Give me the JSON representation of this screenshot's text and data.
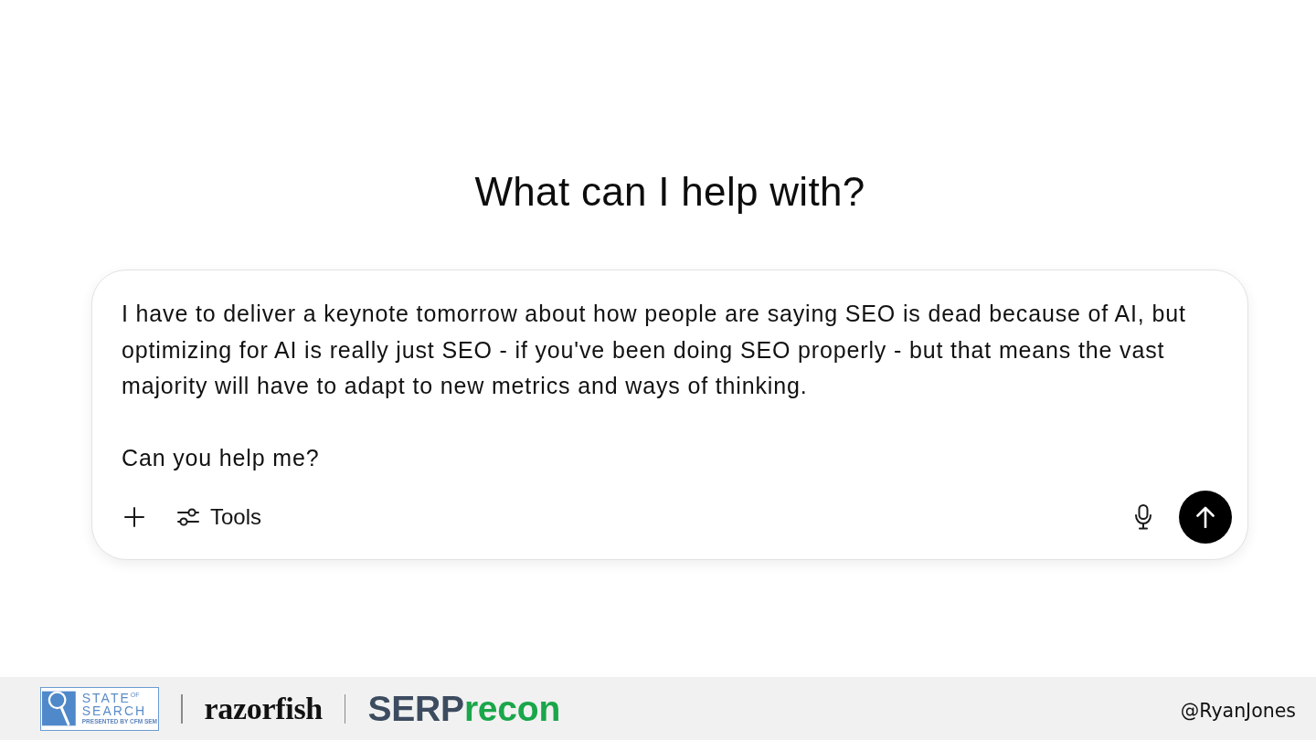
{
  "heading": "What can I help with?",
  "composer": {
    "value": "I have to deliver a keynote tomorrow about how people are saying SEO is dead because of AI, but optimizing for AI is really just SEO - if you've been doing SEO properly - but that means the vast majority will have to adapt to new metrics and ways of thinking.\n\nCan you help me?",
    "tools_label": "Tools"
  },
  "footer": {
    "logos": [
      {
        "kind": "badge",
        "title": [
          "STATE",
          "OF",
          "SEARCH"
        ],
        "tagline": "PRESENTED BY CFM SEM"
      },
      {
        "kind": "serif_wordmark",
        "text": "razorfish"
      },
      {
        "kind": "split_wordmark",
        "parts": [
          "SERP",
          "recon"
        ]
      }
    ],
    "handle": "@RyanJones"
  }
}
